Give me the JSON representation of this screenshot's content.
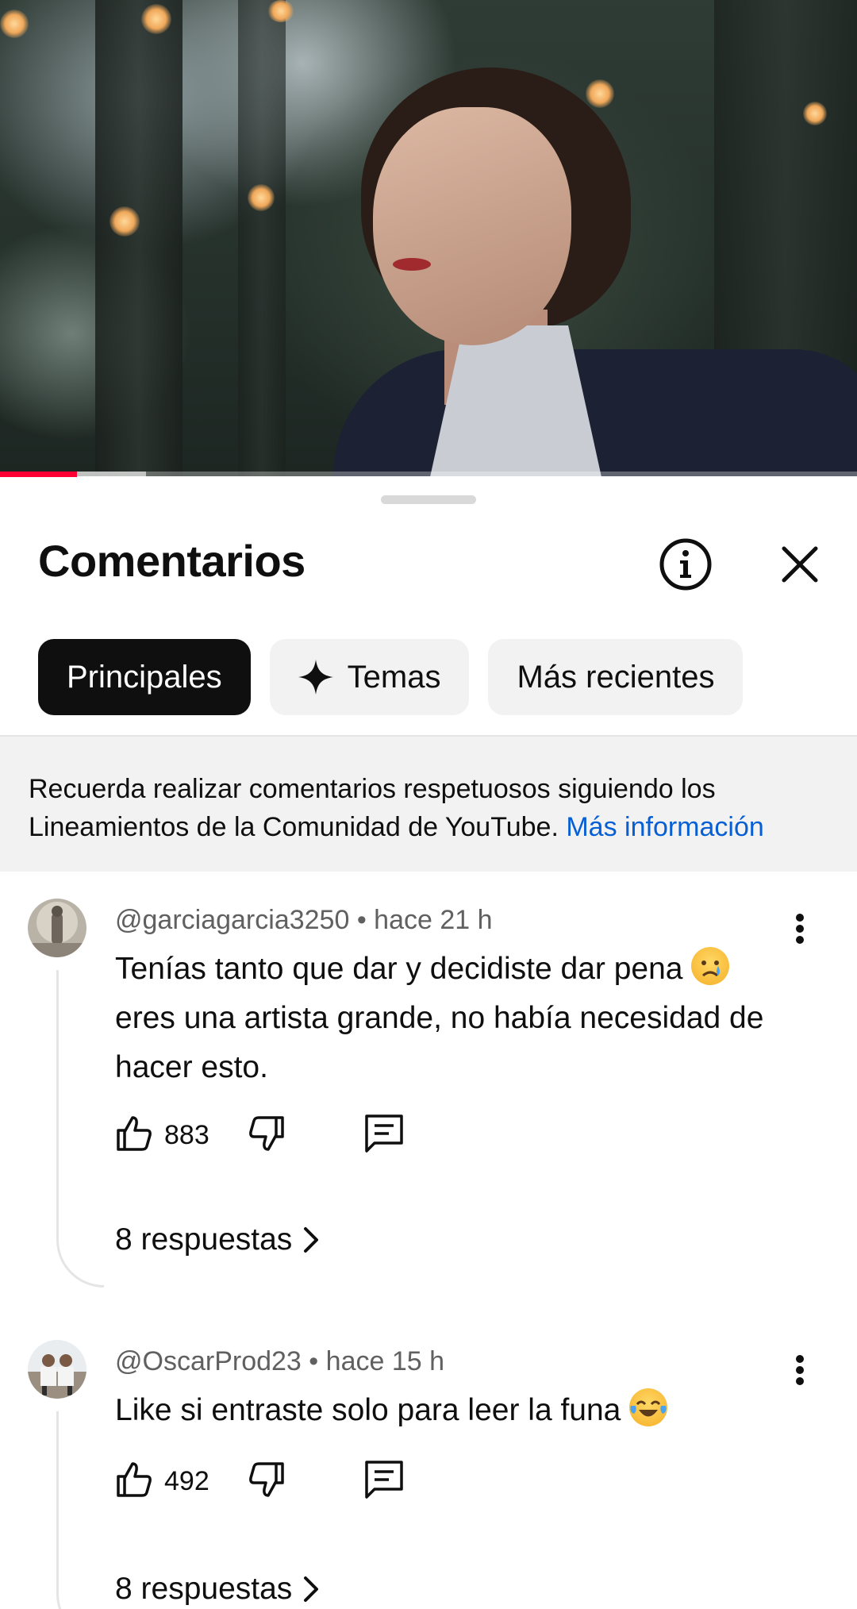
{
  "video": {
    "progress": 0.09,
    "buffered": 0.17
  },
  "sheet": {
    "title": "Comentarios",
    "info_icon": "info-icon",
    "close_icon": "close-icon"
  },
  "filters": [
    {
      "label": "Principales",
      "active": true
    },
    {
      "label": "Temas",
      "icon": "sparkle-icon",
      "active": false
    },
    {
      "label": "Más recientes",
      "active": false
    }
  ],
  "notice": {
    "text": "Recuerda realizar comentarios respetuosos siguiendo los Lineamientos de la Comunidad de YouTube.",
    "link": "Más información"
  },
  "comments": [
    {
      "author": "@garciagarcia3250",
      "time": "hace 21 h",
      "text": "Tenías tanto que dar y decidiste dar pena",
      "text_cont": "eres una artista grande, no había necesidad de hacer esto.",
      "emoji": "crying-face-emoji",
      "likes": "883",
      "replies": "8 respuestas"
    },
    {
      "author": "@OscarProd23",
      "time": "hace 15 h",
      "text": "Like si entraste solo para leer la funa",
      "emoji": "tears-of-joy-emoji",
      "likes": "492",
      "replies": "8 respuestas"
    }
  ],
  "colors": {
    "accent_red": "#ff0033",
    "link_blue": "#065fd4",
    "chip_active": "#0f0f0f",
    "chip_bg": "#f2f2f2"
  }
}
